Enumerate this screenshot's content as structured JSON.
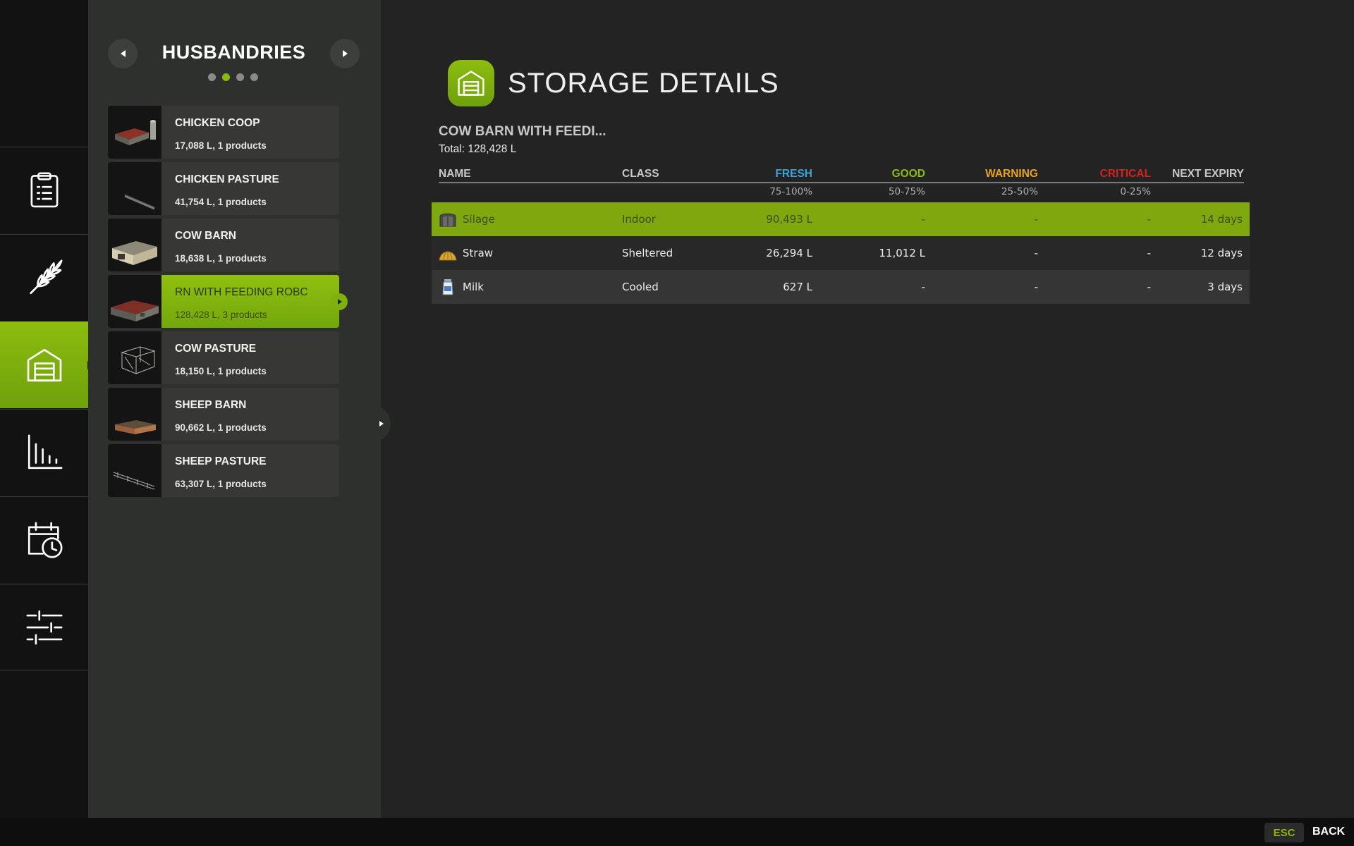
{
  "sidebar": {
    "items": [
      {
        "icon": "clipboard-icon",
        "active": false
      },
      {
        "icon": "wheat-icon",
        "active": false
      },
      {
        "icon": "barn-storage-icon",
        "active": true
      },
      {
        "icon": "bar-chart-icon",
        "active": false
      },
      {
        "icon": "calendar-clock-icon",
        "active": false
      },
      {
        "icon": "sliders-icon",
        "active": false
      }
    ]
  },
  "list": {
    "title": "HUSBANDRIES",
    "page_count": 4,
    "active_page": 2,
    "items": [
      {
        "title": "CHICKEN COOP",
        "subtitle": "17,088 L, 1 products",
        "selected": false
      },
      {
        "title": "CHICKEN PASTURE",
        "subtitle": "41,754 L, 1 products",
        "selected": false
      },
      {
        "title": "COW BARN",
        "subtitle": "18,638 L, 1 products",
        "selected": false
      },
      {
        "title": "RN WITH FEEDING ROBC",
        "subtitle": "128,428 L, 3 products",
        "selected": true
      },
      {
        "title": "COW PASTURE",
        "subtitle": "18,150 L, 1 products",
        "selected": false
      },
      {
        "title": "SHEEP BARN",
        "subtitle": "90,662 L, 1 products",
        "selected": false
      },
      {
        "title": "SHEEP PASTURE",
        "subtitle": "63,307 L, 1 products",
        "selected": false
      }
    ]
  },
  "main": {
    "title": "STORAGE DETAILS",
    "storage_name": "COW BARN WITH FEEDI...",
    "total": "Total: 128,428 L",
    "columns": {
      "name": "NAME",
      "class": "CLASS",
      "fresh": "FRESH",
      "good": "GOOD",
      "warning": "WARNING",
      "critical": "CRITICAL",
      "next_expiry": "NEXT EXPIRY"
    },
    "ranges": {
      "fresh": "75-100%",
      "good": "50-75%",
      "warning": "25-50%",
      "critical": "0-25%"
    },
    "colors": {
      "fresh": "#3aa5d8",
      "good": "#8bbc12",
      "warning": "#e8a418",
      "critical": "#d8211d",
      "accent": "#7ea80d"
    },
    "rows": [
      {
        "name": "Silage",
        "icon": "silage-icon",
        "class": "Indoor",
        "fresh": "90,493 L",
        "good": "-",
        "warning": "-",
        "critical": "-",
        "expiry": "14 days"
      },
      {
        "name": "Straw",
        "icon": "straw-icon",
        "class": "Sheltered",
        "fresh": "26,294 L",
        "good": "11,012 L",
        "warning": "-",
        "critical": "-",
        "expiry": "12 days"
      },
      {
        "name": "Milk",
        "icon": "milk-icon",
        "class": "Cooled",
        "fresh": "627 L",
        "good": "-",
        "warning": "-",
        "critical": "-",
        "expiry": "3 days"
      }
    ]
  },
  "footer": {
    "esc_key": "ESC",
    "back_label": "BACK"
  }
}
